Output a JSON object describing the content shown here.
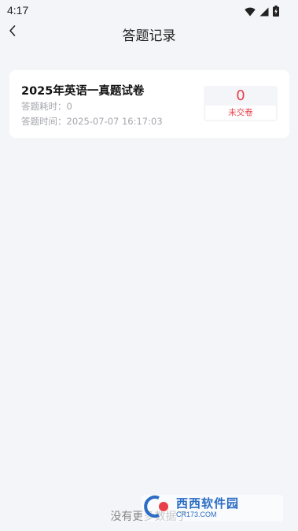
{
  "status_bar": {
    "time": "4:17",
    "icons": [
      "wifi-icon",
      "cellular-signal-icon",
      "battery-charging-icon"
    ]
  },
  "nav": {
    "back_icon": "chevron-left-icon",
    "title": "答题记录"
  },
  "records": [
    {
      "title": "2025年英语一真题试卷",
      "duration": "答题耗时：0",
      "time": "答题时间：2025-07-07 16:17:03",
      "score": "0",
      "status": "未交卷"
    }
  ],
  "footer": {
    "text": "没有更多数据了"
  },
  "watermark": {
    "brand": "西西软件园",
    "url": "CR173.COM"
  },
  "colors": {
    "background": "#f4f5f9",
    "accent_red": "#e8404a",
    "muted_text": "#a4a6ad"
  }
}
